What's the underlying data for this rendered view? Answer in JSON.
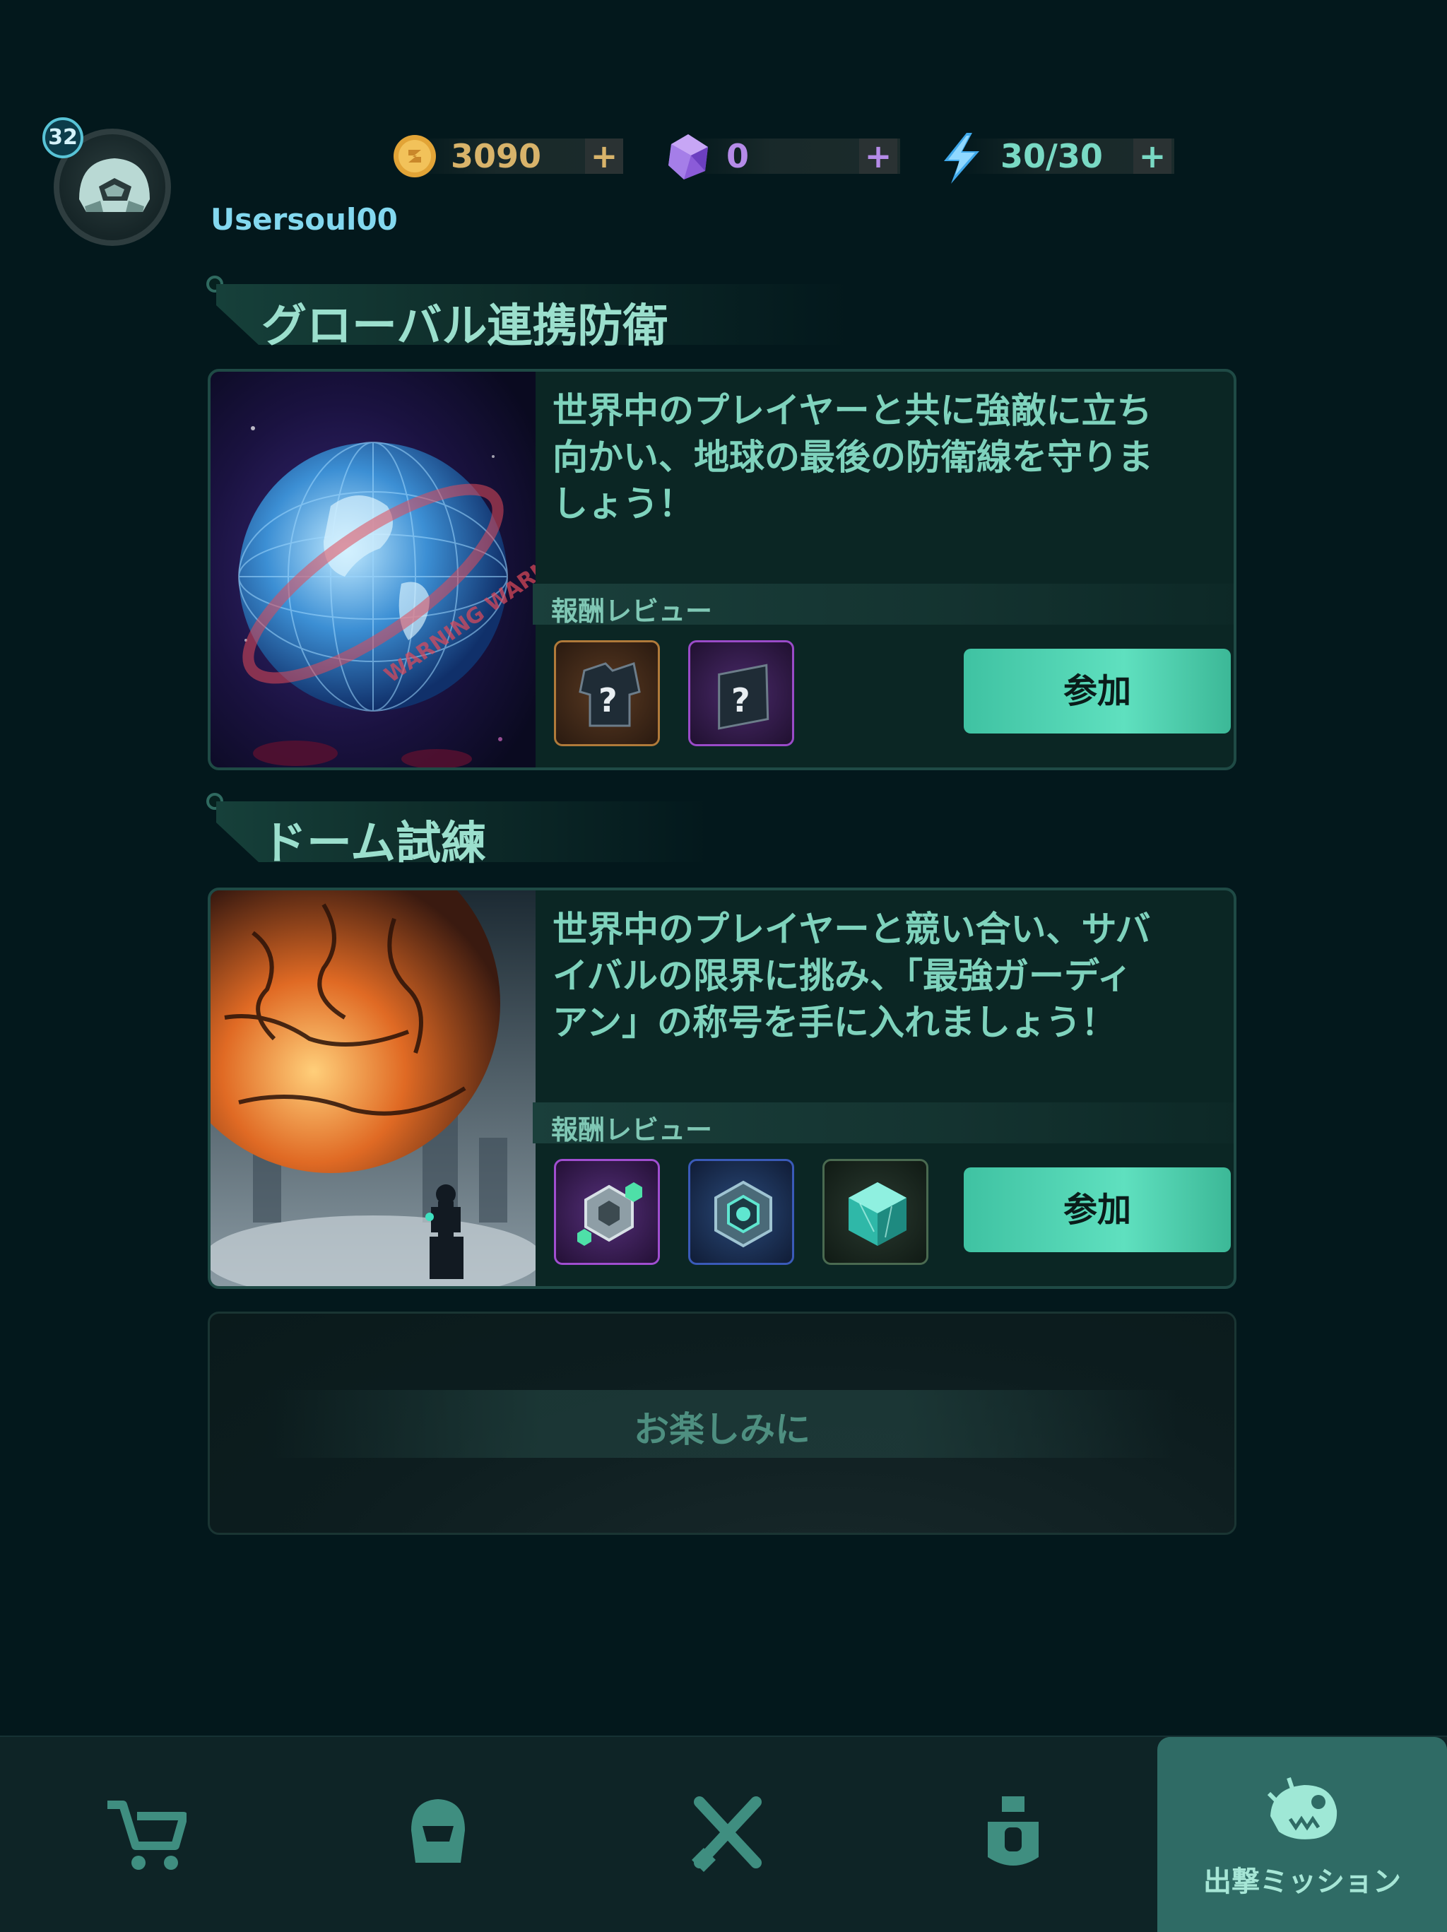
{
  "profile": {
    "level": "32",
    "username": "Usersoul00"
  },
  "currencies": {
    "gold": {
      "value": "3090",
      "plus": "+",
      "icon": "gold-coin-icon",
      "color": "#d8b36a"
    },
    "gems": {
      "value": "0",
      "plus": "+",
      "icon": "purple-gem-icon",
      "color": "#b58be8"
    },
    "energy": {
      "value": "30/30",
      "plus": "+",
      "icon": "lightning-icon",
      "color": "#79d9c4"
    }
  },
  "sections": [
    {
      "title": "グローバル連携防衛",
      "description": "世界中のプレイヤーと共に強敵に立ち向かい、地球の最後の防衛線を守りましょう！",
      "description_lines": [
        "世界中のプレイヤーと共に強敵に立ち",
        "向かい、地球の最後の防衛線を守りま",
        "しょう！"
      ],
      "reward_header": "報酬レビュー",
      "rewards": [
        "mystery-armor-orange-icon",
        "mystery-scroll-purple-icon"
      ],
      "join_label": "参加",
      "art": "warning-globe-art"
    },
    {
      "title": "ドーム試練",
      "description": "世界中のプレイヤーと競い合い、サバイバルの限界に挑み、「最強ガーディアン」の称号を手に入れましょう！",
      "description_lines": [
        "世界中のプレイヤーと競い合い、サバ",
        "イバルの限界に挑み、「最強ガーディ",
        "アン」の称号を手に入れましょう！"
      ],
      "reward_header": "報酬レビュー",
      "rewards": [
        "hex-core-purple-icon",
        "hex-core-blue-icon",
        "crystal-cube-green-icon"
      ],
      "join_label": "参加",
      "art": "burning-dome-art"
    }
  ],
  "coming_soon": "お楽しみに",
  "nav": [
    {
      "icon": "cart-icon",
      "label": ""
    },
    {
      "icon": "helmet-icon",
      "label": ""
    },
    {
      "icon": "crossed-swords-icon",
      "label": ""
    },
    {
      "icon": "robot-tower-icon",
      "label": ""
    },
    {
      "icon": "monster-icon",
      "label": "出撃ミッション",
      "active": true
    }
  ],
  "colors": {
    "background": "#03181c",
    "accent": "#4fd0ae",
    "text": "#7fd3bd"
  }
}
